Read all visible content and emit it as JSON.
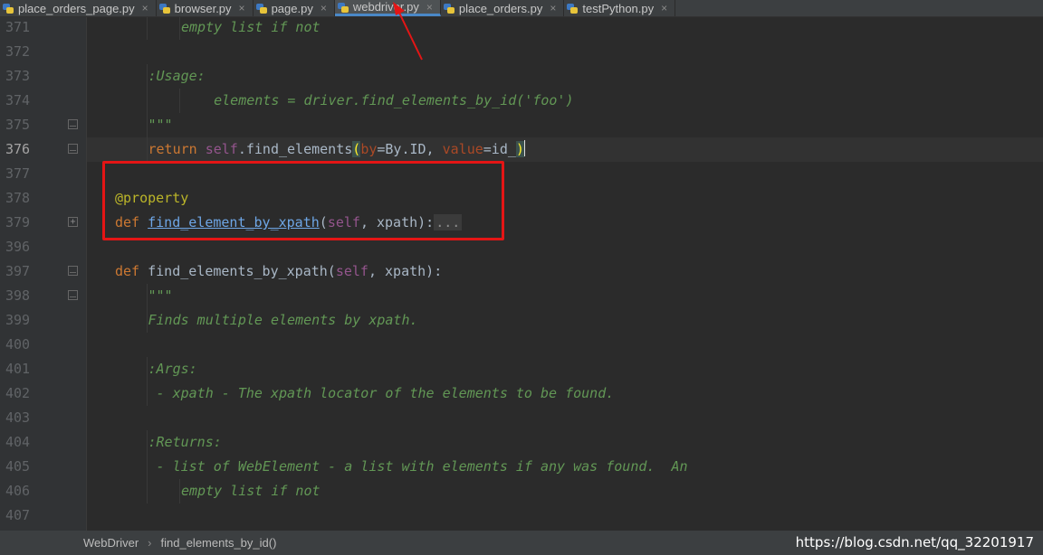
{
  "tabs": [
    {
      "label": "place_orders_page.py",
      "active": false
    },
    {
      "label": "browser.py",
      "active": false
    },
    {
      "label": "page.py",
      "active": false
    },
    {
      "label": "webdriver.py",
      "active": true
    },
    {
      "label": "place_orders.py",
      "active": false
    },
    {
      "label": "testPython.py",
      "active": false
    }
  ],
  "tab_close_glyph": "×",
  "editor": {
    "lines": [
      {
        "num": "371",
        "indent": 3,
        "segments": [
          [
            "doc",
            "empty list if not"
          ]
        ]
      },
      {
        "num": "372",
        "indent": 0,
        "segments": []
      },
      {
        "num": "373",
        "indent": 2,
        "segments": [
          [
            "doc",
            ":Usage:"
          ]
        ]
      },
      {
        "num": "374",
        "indent": 3,
        "segments": [
          [
            "doc",
            "    elements = driver.find_elements_by_id('foo')"
          ]
        ]
      },
      {
        "num": "375",
        "indent": 2,
        "fold": "end",
        "segments": [
          [
            "doc",
            "\"\"\""
          ]
        ]
      },
      {
        "num": "376",
        "indent": 2,
        "fold": "end",
        "current": true,
        "segments": [
          [
            "kw",
            "return "
          ],
          [
            "selfkw",
            "self"
          ],
          [
            "plain",
            ".find_elements"
          ],
          [
            "parenhl",
            "("
          ],
          [
            "named",
            "by"
          ],
          [
            "plain",
            "=By.ID, "
          ],
          [
            "named",
            "value"
          ],
          [
            "plain",
            "=id_"
          ],
          [
            "parenhl",
            ")"
          ],
          [
            "caret",
            ""
          ]
        ]
      },
      {
        "num": "377",
        "indent": 0,
        "segments": []
      },
      {
        "num": "378",
        "indent": 1,
        "segments": [
          [
            "deco",
            "@property"
          ]
        ]
      },
      {
        "num": "379",
        "indent": 1,
        "fold": "collapsed",
        "segments": [
          [
            "kw",
            "def "
          ],
          [
            "link",
            "find_element_by_xpath"
          ],
          [
            "plain",
            "("
          ],
          [
            "selfkw",
            "self"
          ],
          [
            "plain",
            ", xpath):"
          ],
          [
            "folded",
            "..."
          ]
        ]
      },
      {
        "num": "396",
        "indent": 0,
        "segments": []
      },
      {
        "num": "397",
        "indent": 1,
        "fold": "start",
        "segments": [
          [
            "kw",
            "def "
          ],
          [
            "plain",
            "find_elements_by_xpath("
          ],
          [
            "selfkw",
            "self"
          ],
          [
            "plain",
            ", xpath):"
          ]
        ]
      },
      {
        "num": "398",
        "indent": 2,
        "fold": "start",
        "segments": [
          [
            "doc",
            "\"\"\""
          ]
        ]
      },
      {
        "num": "399",
        "indent": 2,
        "segments": [
          [
            "doc",
            "Finds multiple elements by xpath."
          ]
        ]
      },
      {
        "num": "400",
        "indent": 0,
        "segments": []
      },
      {
        "num": "401",
        "indent": 2,
        "segments": [
          [
            "doc",
            ":Args:"
          ]
        ]
      },
      {
        "num": "402",
        "indent": 2,
        "segments": [
          [
            "doc",
            " - xpath - The xpath locator of the elements to be found."
          ]
        ]
      },
      {
        "num": "403",
        "indent": 0,
        "segments": []
      },
      {
        "num": "404",
        "indent": 2,
        "segments": [
          [
            "doc",
            ":Returns:"
          ]
        ]
      },
      {
        "num": "405",
        "indent": 2,
        "segments": [
          [
            "doc",
            " - list of WebElement - a list with elements if any was found.  An"
          ]
        ]
      },
      {
        "num": "406",
        "indent": 3,
        "segments": [
          [
            "doc",
            "empty list if not"
          ]
        ]
      },
      {
        "num": "407",
        "indent": 0,
        "segments": []
      }
    ]
  },
  "statusbar": {
    "breadcrumb": [
      "WebDriver",
      "find_elements_by_id()"
    ],
    "separator": "›",
    "watermark": "https://blog.csdn.net/qq_32201917"
  },
  "colors": {
    "background": "#2b2b2b",
    "docstring": "#629755",
    "keyword": "#cc7832",
    "decorator": "#bbb529",
    "annotation_red": "#e41515",
    "active_tab_underline": "#4a88c7"
  }
}
